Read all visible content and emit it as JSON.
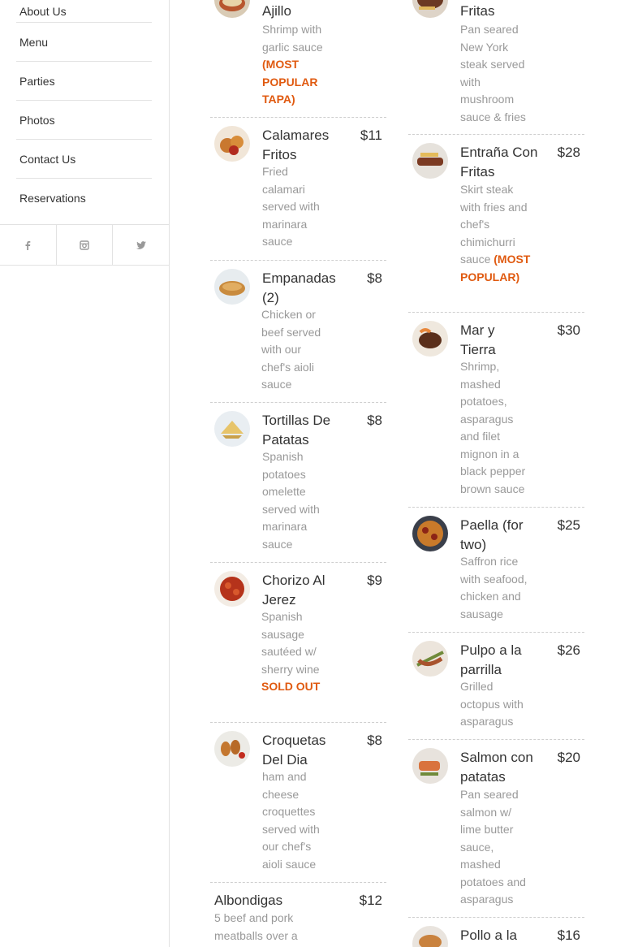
{
  "sidebar": {
    "items": [
      {
        "label": "About Us"
      },
      {
        "label": "Menu"
      },
      {
        "label": "Parties"
      },
      {
        "label": "Photos"
      },
      {
        "label": "Contact Us"
      },
      {
        "label": "Reservations"
      }
    ],
    "social": [
      "facebook-icon",
      "instagram-icon",
      "twitter-icon"
    ]
  },
  "left_menu": [
    {
      "name": "Ajillo",
      "price": "",
      "desc": "Shrimp with garlic sauce",
      "tag": "(MOST POPULAR TAPA)"
    },
    {
      "name": "Calamares Fritos",
      "price": "$11",
      "desc": "Fried calamari served with marinara sauce",
      "tag": ""
    },
    {
      "name": "Empanadas (2)",
      "price": "$8",
      "desc": "Chicken or beef served with our chef's aioli sauce",
      "tag": ""
    },
    {
      "name": "Tortillas De Patatas",
      "price": "$8",
      "desc": "Spanish potatoes omelette served with marinara sauce",
      "tag": ""
    },
    {
      "name": "Chorizo Al Jerez",
      "price": "$9",
      "desc": "Spanish sausage sautéed w/ sherry wine",
      "tag": "SOLD OUT"
    },
    {
      "name": "Croquetas Del Dia",
      "price": "$8",
      "desc": "ham and cheese croquettes served with our chef's aioli sauce",
      "tag": ""
    },
    {
      "name": "Albondigas",
      "price": "$12",
      "desc": "5 beef and pork meatballs over a",
      "tag": ""
    }
  ],
  "right_menu": [
    {
      "name": "Fritas",
      "price": "",
      "desc": "Pan seared New York steak served with mushroom sauce & fries",
      "tag": ""
    },
    {
      "name": "Entraña Con Fritas",
      "price": "$28",
      "desc": "Skirt steak with fries and chef's chimichurri sauce",
      "tag": "(MOST POPULAR)"
    },
    {
      "name": "Mar y Tierra",
      "price": "$30",
      "desc": "Shrimp, mashed potatoes, asparagus and filet mignon in a black pepper brown sauce",
      "tag": ""
    },
    {
      "name": "Paella (for two)",
      "price": "$25",
      "desc": "Saffron rice with seafood, chicken and sausage",
      "tag": ""
    },
    {
      "name": "Pulpo a la parrilla",
      "price": "$26",
      "desc": "Grilled octopus with asparagus",
      "tag": ""
    },
    {
      "name": "Salmon con patatas",
      "price": "$20",
      "desc": "Pan seared salmon w/ lime butter sauce, mashed potatoes and asparagus",
      "tag": ""
    },
    {
      "name": "Pollo a la",
      "price": "$16",
      "desc": "",
      "tag": ""
    }
  ],
  "colors": {
    "accent": "#e05a10",
    "text": "#333333",
    "muted": "#999999"
  }
}
